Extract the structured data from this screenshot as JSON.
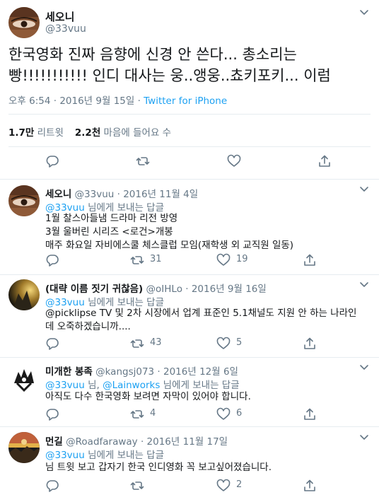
{
  "main_tweet": {
    "name": "세오니",
    "handle": "@33vuu",
    "text_line1": "한국영화 진짜 음향에 신경 안 쓴다... 총소리는",
    "text_line2": "빵!!!!!!!!!!! 인디 대사는 웅..앵웅..쵸키포키... 이럼",
    "time": "오후 6:54 · 2016년 9월 15일 · ",
    "source": "Twitter for iPhone",
    "retweets_count": "1.7만",
    "retweets_label": "리트윗",
    "likes_count": "2.2천",
    "likes_label": "마음에 들어요 수"
  },
  "replies": [
    {
      "name": "세오니",
      "meta": " @33vuu · 2016년 11월 4일",
      "to_handle": "@33vuu",
      "to_suffix": " 님에게 보내는 답글",
      "lines": [
        "1월 찰스아들냄 드라마 리전 방영",
        "3월 울버린 시리즈 <로건>개봉",
        "매주 화요일 자비에스쿨 체스클럽 모임(재학생 외 교직원 일동)"
      ],
      "retweets": "31",
      "likes": "19"
    },
    {
      "name": "(대략 이름 짓기 귀찮음)",
      "meta": " @oIHLo · 2016년 9월 16일",
      "to_handle": "@33vuu",
      "to_suffix": " 님에게 보내는 답글",
      "lines": [
        "@picklipse TV 및 2차 시장에서 업계 표준인 5.1채널도 지원 안 하는 나라인",
        "데 오죽하겠습니까...."
      ],
      "retweets": "43",
      "likes": "5"
    },
    {
      "name": "미개한 봉족",
      "meta": " @kangsj073 · 2016년 12월 6일",
      "to_handle": "@33vuu",
      "to_mid": " 님, ",
      "to_handle2": "@Lainworks",
      "to_suffix": " 님에게 보내는 답글",
      "lines": [
        "아직도 다수 한국영화 보려면 자막이 있어야 합니다."
      ],
      "retweets": "4",
      "likes": "6"
    },
    {
      "name": "먼길",
      "meta": " @Roadfaraway · 2016년 11월 17일",
      "to_handle": "@33vuu",
      "to_suffix": " 님에게 보내는 답글",
      "lines": [
        "님 트윗 보고 갑자기 한국 인디영화 꼭 보고싶어졌습니다."
      ],
      "retweets": "",
      "likes": "2"
    }
  ],
  "icons": {
    "reply": "reply-icon",
    "retweet": "retweet-icon",
    "like": "heart-icon",
    "share": "share-icon",
    "more": "chevron-down-icon"
  },
  "colors": {
    "link": "#1da1f2",
    "secondary": "#657786",
    "divider": "#e6ecf0"
  }
}
